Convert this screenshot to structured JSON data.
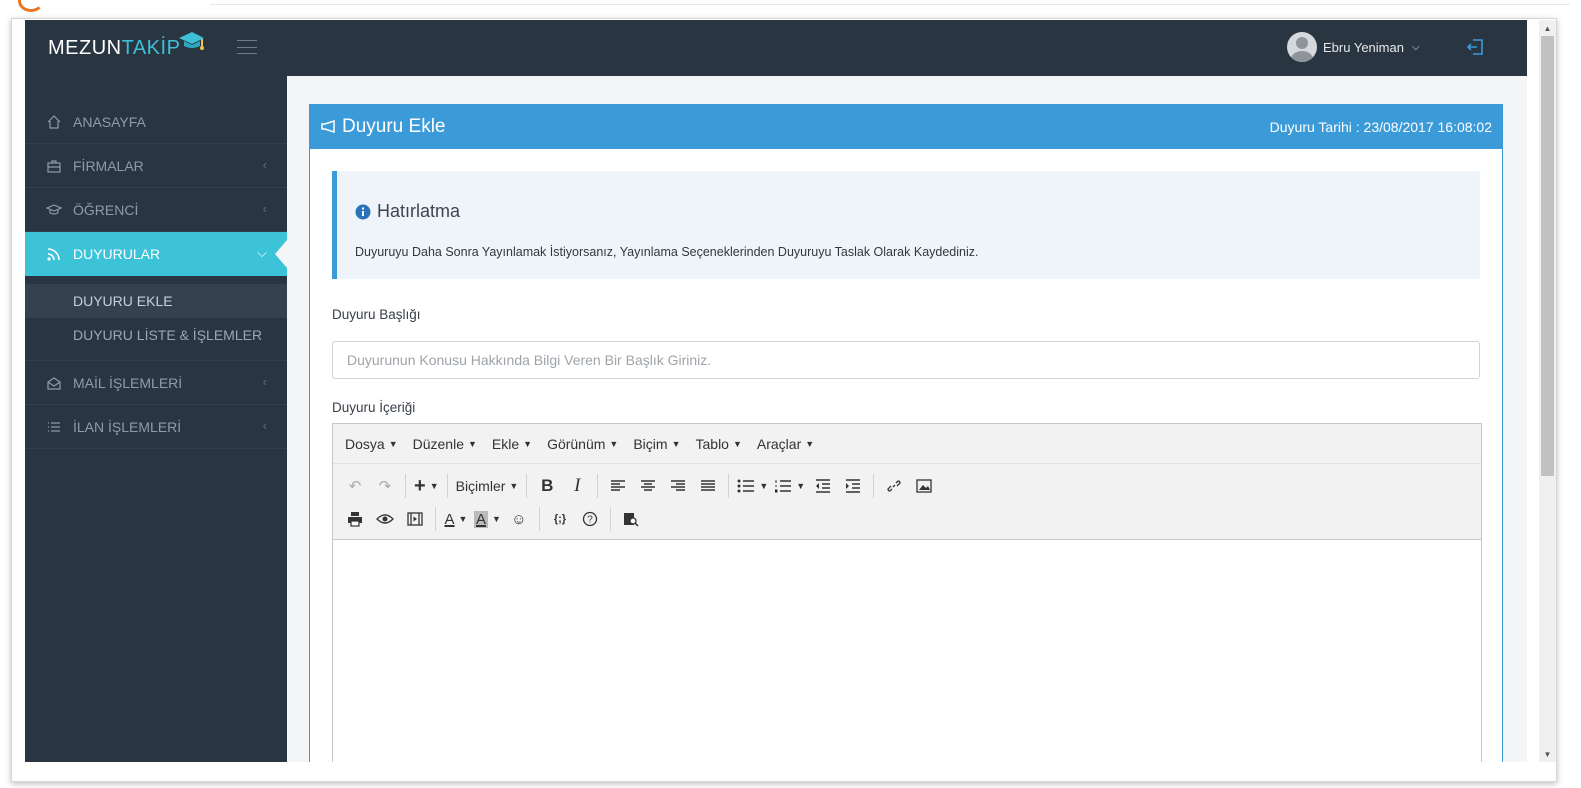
{
  "brand": {
    "main": "MEZUN",
    "accent": "TAKİP"
  },
  "user": {
    "name": "Ebru Yeniman"
  },
  "colors": {
    "sidebar": "#2a3542",
    "active": "#3cc3d8",
    "panel": "#3b9bd9"
  },
  "sidebar": {
    "items": [
      {
        "label": "ANASAYFA",
        "icon": "home-icon"
      },
      {
        "label": "FİRMALAR",
        "icon": "briefcase-icon"
      },
      {
        "label": "ÖĞRENCİ",
        "icon": "graduation-cap-icon"
      },
      {
        "label": "DUYURULAR",
        "icon": "rss-icon"
      },
      {
        "label": "MAİL İŞLEMLERİ",
        "icon": "envelope-icon"
      },
      {
        "label": "İLAN İŞLEMLERİ",
        "icon": "list-icon"
      }
    ],
    "submenu": [
      {
        "label": "DUYURU EKLE"
      },
      {
        "label": "DUYURU LİSTE & İŞLEMLER"
      }
    ]
  },
  "panel": {
    "title": "Duyuru Ekle",
    "date": "Duyuru Tarihi : 23/08/2017 16:08:02"
  },
  "alert": {
    "title": "Hatırlatma",
    "text": "Duyuruyu Daha Sonra Yayınlamak İstiyorsanız, Yayınlama Seçeneklerinden Duyuruyu Taslak Olarak Kaydediniz."
  },
  "form": {
    "title_label": "Duyuru Başlığı",
    "title_placeholder": "Duyurunun Konusu Hakkında Bilgi Veren Bir Başlık Giriniz.",
    "content_label": "Duyuru İçeriği"
  },
  "editor": {
    "menus": [
      "Dosya",
      "Düzenle",
      "Ekle",
      "Görünüm",
      "Biçim",
      "Tablo",
      "Araçlar"
    ],
    "formats_label": "Biçimler",
    "bold": "B",
    "italic": "I",
    "text_color": "A",
    "bg_color": "A",
    "code": "{;}"
  }
}
